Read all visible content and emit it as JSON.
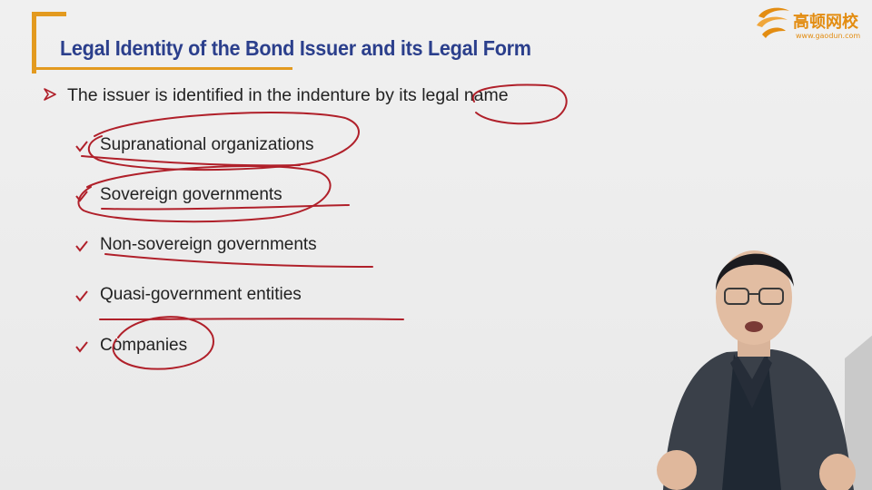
{
  "slide": {
    "title": "Legal Identity of the Bond Issuer and its Legal Form",
    "main_point": "The issuer is identified in the indenture by its legal name",
    "items": [
      {
        "label": "Supranational organizations"
      },
      {
        "label": "Sovereign governments"
      },
      {
        "label": "Non-sovereign governments"
      },
      {
        "label": "Quasi-government entities"
      },
      {
        "label": "Companies"
      }
    ]
  },
  "logo": {
    "name": "高顿网校",
    "url": "www.gaodun.com",
    "icon": "gaodun-logo-icon"
  },
  "colors": {
    "title": "#2b3f8c",
    "accent": "#e39a1f",
    "annotation_ink": "#b0202a",
    "bullet": "#b0202a"
  }
}
